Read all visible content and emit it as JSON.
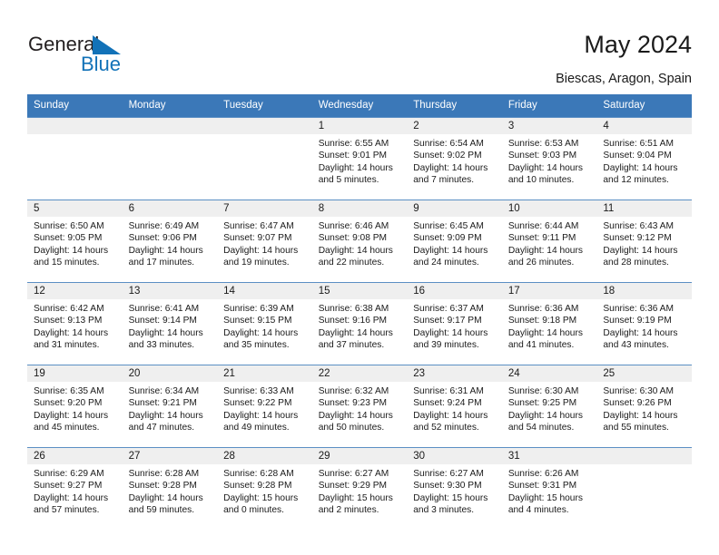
{
  "logo": {
    "text_general": "General",
    "text_blue": "Blue",
    "triangle_color": "#1272b8",
    "general_color": "#231f20"
  },
  "header": {
    "title": "May 2024",
    "subtitle": "Biescas, Aragon, Spain"
  },
  "colors": {
    "header_blue": "#3b78b8",
    "row_divider": "#5b8fc4",
    "daynum_band": "#efefef",
    "text": "#1a1a1a"
  },
  "weekdays": [
    "Sunday",
    "Monday",
    "Tuesday",
    "Wednesday",
    "Thursday",
    "Friday",
    "Saturday"
  ],
  "weeks": [
    [
      {
        "day": "",
        "empty": true
      },
      {
        "day": "",
        "empty": true
      },
      {
        "day": "",
        "empty": true
      },
      {
        "day": "1",
        "sunrise": "Sunrise: 6:55 AM",
        "sunset": "Sunset: 9:01 PM",
        "daylight1": "Daylight: 14 hours",
        "daylight2": "and 5 minutes."
      },
      {
        "day": "2",
        "sunrise": "Sunrise: 6:54 AM",
        "sunset": "Sunset: 9:02 PM",
        "daylight1": "Daylight: 14 hours",
        "daylight2": "and 7 minutes."
      },
      {
        "day": "3",
        "sunrise": "Sunrise: 6:53 AM",
        "sunset": "Sunset: 9:03 PM",
        "daylight1": "Daylight: 14 hours",
        "daylight2": "and 10 minutes."
      },
      {
        "day": "4",
        "sunrise": "Sunrise: 6:51 AM",
        "sunset": "Sunset: 9:04 PM",
        "daylight1": "Daylight: 14 hours",
        "daylight2": "and 12 minutes."
      }
    ],
    [
      {
        "day": "5",
        "sunrise": "Sunrise: 6:50 AM",
        "sunset": "Sunset: 9:05 PM",
        "daylight1": "Daylight: 14 hours",
        "daylight2": "and 15 minutes."
      },
      {
        "day": "6",
        "sunrise": "Sunrise: 6:49 AM",
        "sunset": "Sunset: 9:06 PM",
        "daylight1": "Daylight: 14 hours",
        "daylight2": "and 17 minutes."
      },
      {
        "day": "7",
        "sunrise": "Sunrise: 6:47 AM",
        "sunset": "Sunset: 9:07 PM",
        "daylight1": "Daylight: 14 hours",
        "daylight2": "and 19 minutes."
      },
      {
        "day": "8",
        "sunrise": "Sunrise: 6:46 AM",
        "sunset": "Sunset: 9:08 PM",
        "daylight1": "Daylight: 14 hours",
        "daylight2": "and 22 minutes."
      },
      {
        "day": "9",
        "sunrise": "Sunrise: 6:45 AM",
        "sunset": "Sunset: 9:09 PM",
        "daylight1": "Daylight: 14 hours",
        "daylight2": "and 24 minutes."
      },
      {
        "day": "10",
        "sunrise": "Sunrise: 6:44 AM",
        "sunset": "Sunset: 9:11 PM",
        "daylight1": "Daylight: 14 hours",
        "daylight2": "and 26 minutes."
      },
      {
        "day": "11",
        "sunrise": "Sunrise: 6:43 AM",
        "sunset": "Sunset: 9:12 PM",
        "daylight1": "Daylight: 14 hours",
        "daylight2": "and 28 minutes."
      }
    ],
    [
      {
        "day": "12",
        "sunrise": "Sunrise: 6:42 AM",
        "sunset": "Sunset: 9:13 PM",
        "daylight1": "Daylight: 14 hours",
        "daylight2": "and 31 minutes."
      },
      {
        "day": "13",
        "sunrise": "Sunrise: 6:41 AM",
        "sunset": "Sunset: 9:14 PM",
        "daylight1": "Daylight: 14 hours",
        "daylight2": "and 33 minutes."
      },
      {
        "day": "14",
        "sunrise": "Sunrise: 6:39 AM",
        "sunset": "Sunset: 9:15 PM",
        "daylight1": "Daylight: 14 hours",
        "daylight2": "and 35 minutes."
      },
      {
        "day": "15",
        "sunrise": "Sunrise: 6:38 AM",
        "sunset": "Sunset: 9:16 PM",
        "daylight1": "Daylight: 14 hours",
        "daylight2": "and 37 minutes."
      },
      {
        "day": "16",
        "sunrise": "Sunrise: 6:37 AM",
        "sunset": "Sunset: 9:17 PM",
        "daylight1": "Daylight: 14 hours",
        "daylight2": "and 39 minutes."
      },
      {
        "day": "17",
        "sunrise": "Sunrise: 6:36 AM",
        "sunset": "Sunset: 9:18 PM",
        "daylight1": "Daylight: 14 hours",
        "daylight2": "and 41 minutes."
      },
      {
        "day": "18",
        "sunrise": "Sunrise: 6:36 AM",
        "sunset": "Sunset: 9:19 PM",
        "daylight1": "Daylight: 14 hours",
        "daylight2": "and 43 minutes."
      }
    ],
    [
      {
        "day": "19",
        "sunrise": "Sunrise: 6:35 AM",
        "sunset": "Sunset: 9:20 PM",
        "daylight1": "Daylight: 14 hours",
        "daylight2": "and 45 minutes."
      },
      {
        "day": "20",
        "sunrise": "Sunrise: 6:34 AM",
        "sunset": "Sunset: 9:21 PM",
        "daylight1": "Daylight: 14 hours",
        "daylight2": "and 47 minutes."
      },
      {
        "day": "21",
        "sunrise": "Sunrise: 6:33 AM",
        "sunset": "Sunset: 9:22 PM",
        "daylight1": "Daylight: 14 hours",
        "daylight2": "and 49 minutes."
      },
      {
        "day": "22",
        "sunrise": "Sunrise: 6:32 AM",
        "sunset": "Sunset: 9:23 PM",
        "daylight1": "Daylight: 14 hours",
        "daylight2": "and 50 minutes."
      },
      {
        "day": "23",
        "sunrise": "Sunrise: 6:31 AM",
        "sunset": "Sunset: 9:24 PM",
        "daylight1": "Daylight: 14 hours",
        "daylight2": "and 52 minutes."
      },
      {
        "day": "24",
        "sunrise": "Sunrise: 6:30 AM",
        "sunset": "Sunset: 9:25 PM",
        "daylight1": "Daylight: 14 hours",
        "daylight2": "and 54 minutes."
      },
      {
        "day": "25",
        "sunrise": "Sunrise: 6:30 AM",
        "sunset": "Sunset: 9:26 PM",
        "daylight1": "Daylight: 14 hours",
        "daylight2": "and 55 minutes."
      }
    ],
    [
      {
        "day": "26",
        "sunrise": "Sunrise: 6:29 AM",
        "sunset": "Sunset: 9:27 PM",
        "daylight1": "Daylight: 14 hours",
        "daylight2": "and 57 minutes."
      },
      {
        "day": "27",
        "sunrise": "Sunrise: 6:28 AM",
        "sunset": "Sunset: 9:28 PM",
        "daylight1": "Daylight: 14 hours",
        "daylight2": "and 59 minutes."
      },
      {
        "day": "28",
        "sunrise": "Sunrise: 6:28 AM",
        "sunset": "Sunset: 9:28 PM",
        "daylight1": "Daylight: 15 hours",
        "daylight2": "and 0 minutes."
      },
      {
        "day": "29",
        "sunrise": "Sunrise: 6:27 AM",
        "sunset": "Sunset: 9:29 PM",
        "daylight1": "Daylight: 15 hours",
        "daylight2": "and 2 minutes."
      },
      {
        "day": "30",
        "sunrise": "Sunrise: 6:27 AM",
        "sunset": "Sunset: 9:30 PM",
        "daylight1": "Daylight: 15 hours",
        "daylight2": "and 3 minutes."
      },
      {
        "day": "31",
        "sunrise": "Sunrise: 6:26 AM",
        "sunset": "Sunset: 9:31 PM",
        "daylight1": "Daylight: 15 hours",
        "daylight2": "and 4 minutes."
      },
      {
        "day": "",
        "empty": true
      }
    ]
  ]
}
